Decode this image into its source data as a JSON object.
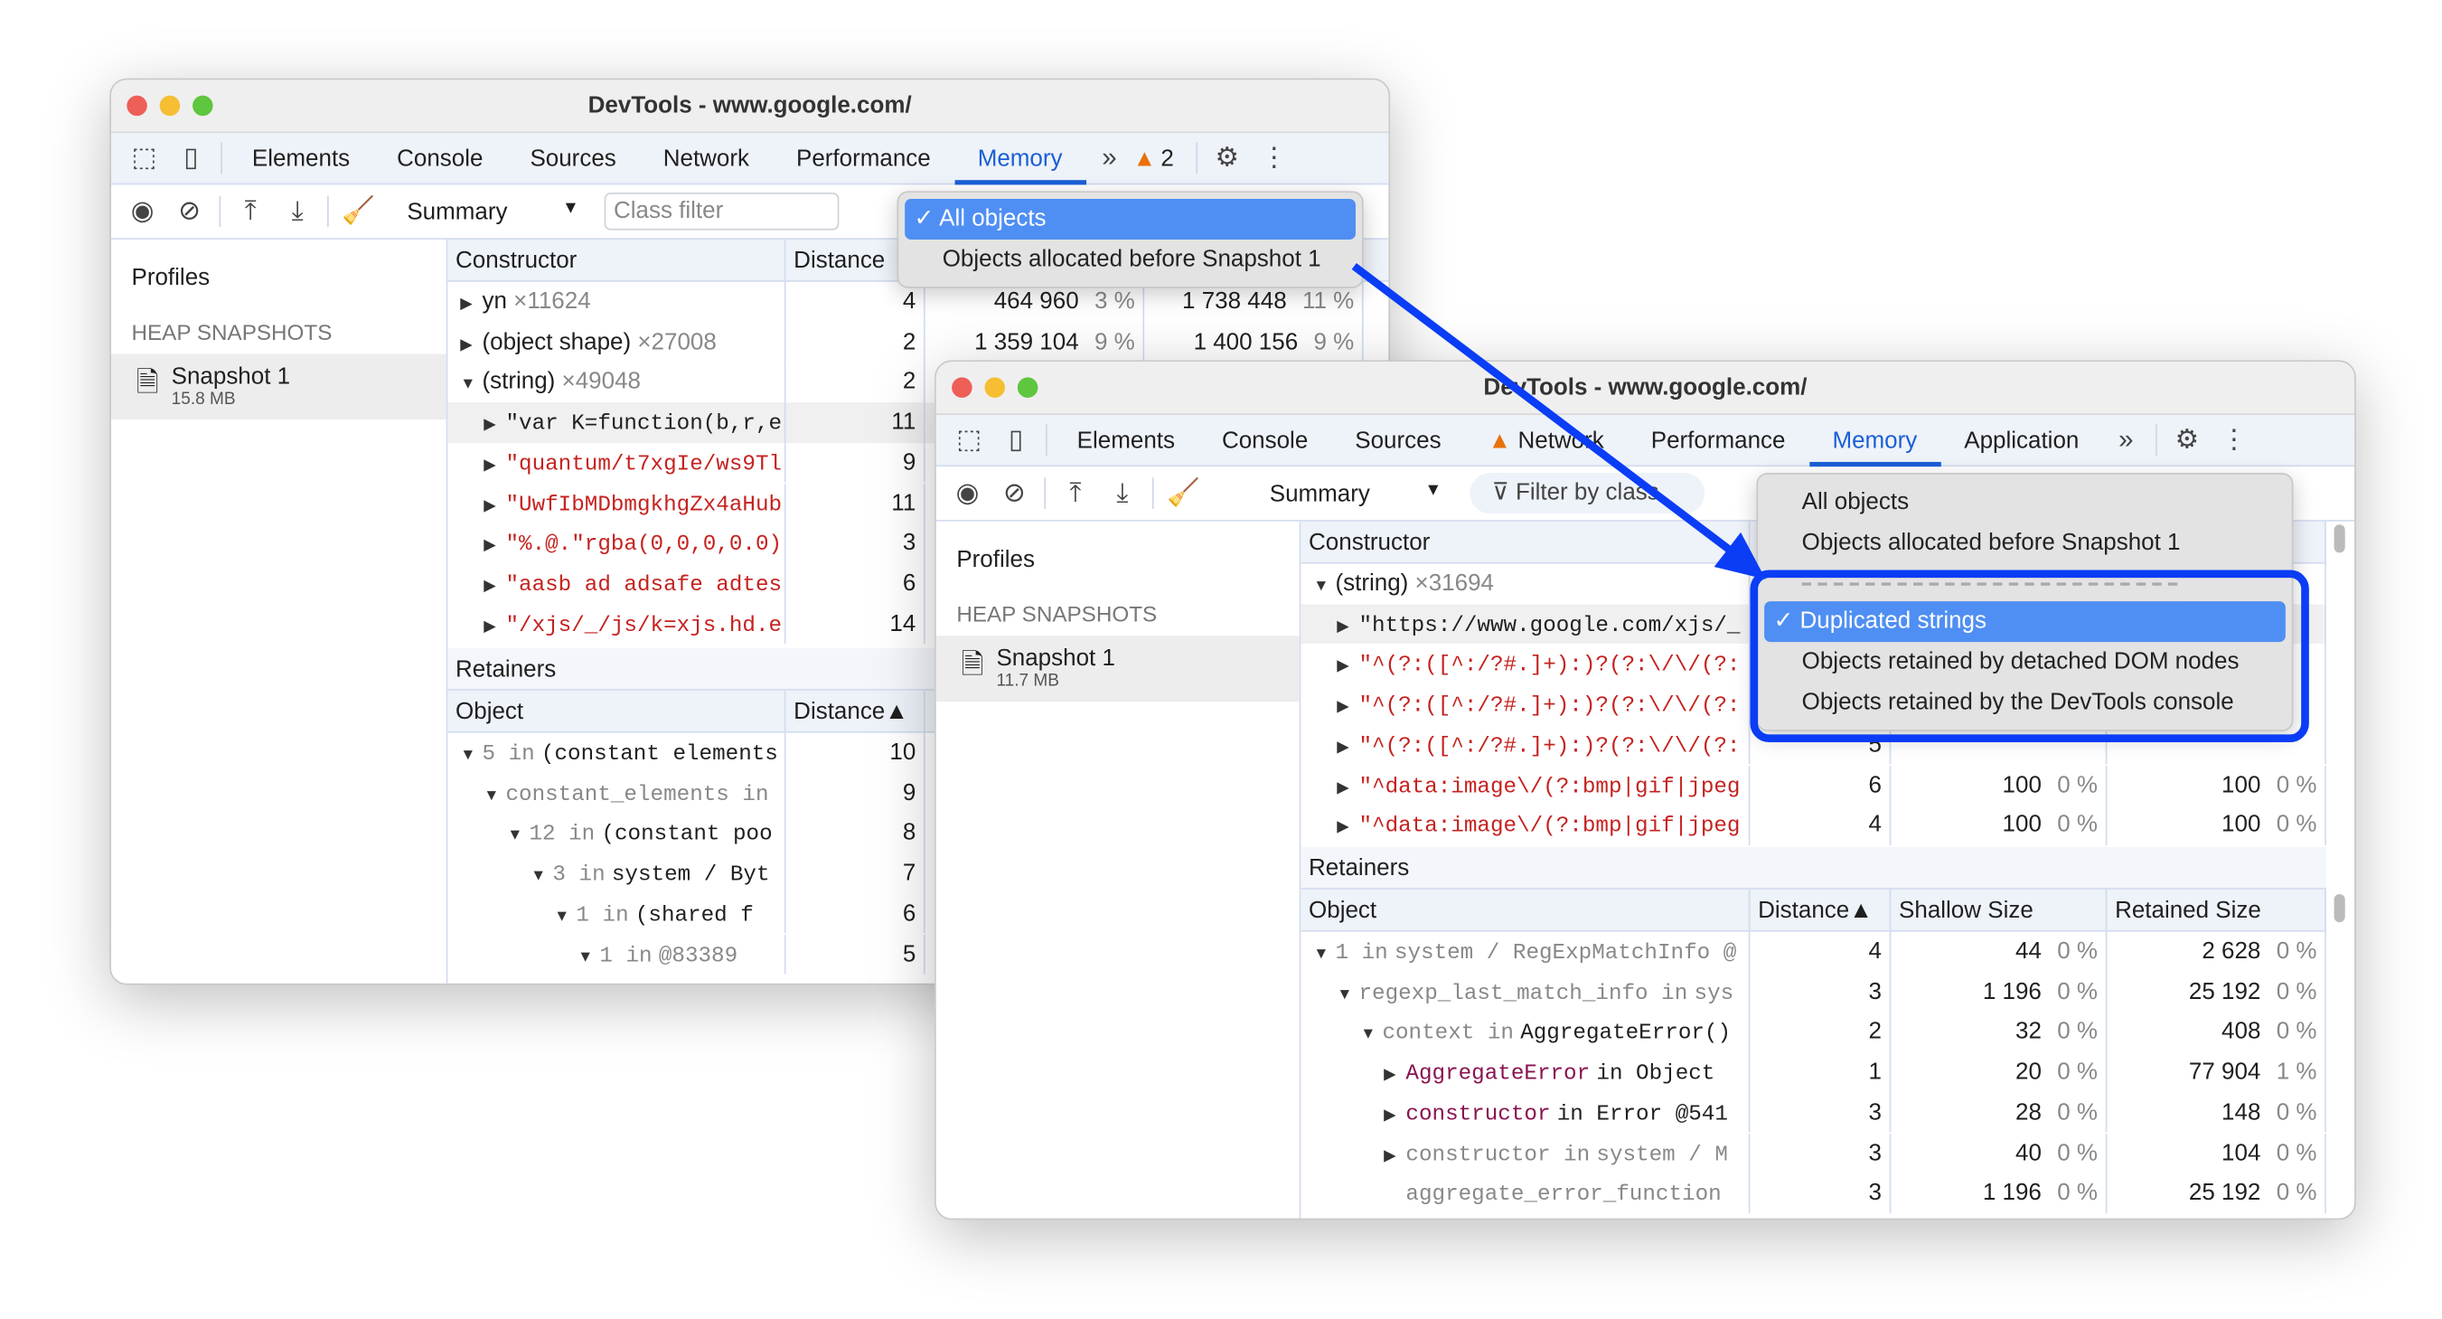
{
  "colors": {
    "accent": "#1a5fd6",
    "highlight": "#0a3df5",
    "menu_selected": "#4f8ff3",
    "string_red": "#c5221f"
  },
  "back": {
    "title": "DevTools - www.google.com/",
    "tabs": [
      "Elements",
      "Console",
      "Sources",
      "Network",
      "Performance",
      "Memory"
    ],
    "active_tab": "Memory",
    "warnings": "2",
    "view": "Summary",
    "class_filter_placeholder": "Class filter",
    "sidebar": {
      "profiles": "Profiles",
      "heap_snapshots": "HEAP SNAPSHOTS",
      "snapshot_name": "Snapshot 1",
      "snapshot_size": "15.8 MB"
    },
    "menu": {
      "items": [
        "All objects",
        "Objects allocated before Snapshot 1"
      ],
      "selected": "All objects"
    },
    "table": {
      "headers": [
        "Constructor",
        "Distance"
      ],
      "rows": [
        {
          "indent": 0,
          "arrow": "right",
          "name": "yn",
          "count": "×11624",
          "distance": "4",
          "shallow": "464 960",
          "shallow_pct": "3 %",
          "retained": "1 738 448",
          "retained_pct": "11 %"
        },
        {
          "indent": 0,
          "arrow": "right",
          "name": "(object shape)",
          "count": "×27008",
          "distance": "2",
          "shallow": "1 359 104",
          "shallow_pct": "9 %",
          "retained": "1 400 156",
          "retained_pct": "9 %"
        },
        {
          "indent": 0,
          "arrow": "down",
          "name": "(string)",
          "count": "×49048",
          "distance": "2"
        },
        {
          "indent": 1,
          "arrow": "right",
          "name": "\"var K=function(b,r,e",
          "style": "mono",
          "distance": "11",
          "selected": true
        },
        {
          "indent": 1,
          "arrow": "right",
          "name": "\"quantum/t7xgIe/ws9Tl",
          "style": "mono red",
          "distance": "9"
        },
        {
          "indent": 1,
          "arrow": "right",
          "name": "\"UwfIbMDbmgkhgZx4aHub",
          "style": "mono red",
          "distance": "11"
        },
        {
          "indent": 1,
          "arrow": "right",
          "name": "\"%.@.\"rgba(0,0,0,0.0)",
          "style": "mono red",
          "distance": "3"
        },
        {
          "indent": 1,
          "arrow": "right",
          "name": "\"aasb ad adsafe adtes",
          "style": "mono red",
          "distance": "6"
        },
        {
          "indent": 1,
          "arrow": "right",
          "name": "\"/xjs/_/js/k=xjs.hd.e",
          "style": "mono red",
          "distance": "14"
        }
      ]
    },
    "retainers": {
      "title": "Retainers",
      "headers": [
        "Object",
        "Distance▲"
      ],
      "rows": [
        {
          "indent": 0,
          "arrow": "down",
          "prefix": "5 in",
          "name": "(constant elements",
          "style": "mono",
          "distance": "10"
        },
        {
          "indent": 1,
          "arrow": "down",
          "prefix": "constant_elements in",
          "name": "",
          "style": "mono",
          "distance": "9"
        },
        {
          "indent": 2,
          "arrow": "down",
          "prefix": "12 in",
          "name": "(constant poo",
          "style": "mono",
          "distance": "8"
        },
        {
          "indent": 3,
          "arrow": "down",
          "prefix": "3 in",
          "name": "system / Byt",
          "style": "mono",
          "distance": "7"
        },
        {
          "indent": 4,
          "arrow": "down",
          "prefix": "1 in",
          "name": "(shared f",
          "style": "mono",
          "distance": "6"
        },
        {
          "indent": 5,
          "arrow": "down",
          "prefix": "1 in",
          "name": "@83389",
          "style": "mono grey",
          "distance": "5"
        }
      ]
    }
  },
  "front": {
    "title": "DevTools - www.google.com/",
    "tabs": [
      "Elements",
      "Console",
      "Sources",
      "Network",
      "Performance",
      "Memory",
      "Application"
    ],
    "active_tab": "Memory",
    "view": "Summary",
    "class_filter_placeholder": "Filter by class",
    "sidebar": {
      "profiles": "Profiles",
      "heap_snapshots": "HEAP SNAPSHOTS",
      "snapshot_name": "Snapshot 1",
      "snapshot_size": "11.7 MB"
    },
    "menu": {
      "items": [
        "All objects",
        "Objects allocated before Snapshot 1"
      ],
      "highlighted_items": [
        "Duplicated strings",
        "Objects retained by detached DOM nodes",
        "Objects retained by the DevTools console"
      ],
      "selected": "Duplicated strings"
    },
    "table": {
      "headers": [
        "Constructor"
      ],
      "rows": [
        {
          "indent": 0,
          "arrow": "down",
          "name": "(string)",
          "count": "×31694"
        },
        {
          "indent": 1,
          "arrow": "right",
          "name": "\"https://www.google.com/xjs/_",
          "style": "mono",
          "selected": true
        },
        {
          "indent": 1,
          "arrow": "right",
          "name": "\"^(?:([^:/?#.]+):)?(?:\\/\\/(?:",
          "style": "mono red"
        },
        {
          "indent": 1,
          "arrow": "right",
          "name": "\"^(?:([^:/?#.]+):)?(?:\\/\\/(?:",
          "style": "mono red"
        },
        {
          "indent": 1,
          "arrow": "right",
          "name": "\"^(?:([^:/?#.]+):)?(?:\\/\\/(?:",
          "style": "mono red",
          "distance": "5"
        },
        {
          "indent": 1,
          "arrow": "right",
          "name": "\"^data:image\\/(?:bmp|gif|jpeg",
          "style": "mono red",
          "distance": "6",
          "shallow": "100",
          "shallow_pct": "0 %",
          "retained": "100",
          "retained_pct": "0 %"
        },
        {
          "indent": 1,
          "arrow": "right",
          "name": "\"^data:image\\/(?:bmp|gif|jpeg",
          "style": "mono red",
          "distance": "4",
          "shallow": "100",
          "shallow_pct": "0 %",
          "retained": "100",
          "retained_pct": "0 %"
        }
      ]
    },
    "retainers": {
      "title": "Retainers",
      "headers": [
        "Object",
        "Distance▲",
        "Shallow Size",
        "Retained Size"
      ],
      "rows": [
        {
          "indent": 0,
          "arrow": "down",
          "prefix": "1 in",
          "name": "system / RegExpMatchInfo @",
          "style": "mono grey",
          "distance": "4",
          "shallow": "44",
          "shallow_pct": "0 %",
          "retained": "2 628",
          "retained_pct": "0 %"
        },
        {
          "indent": 1,
          "arrow": "down",
          "prefix": "regexp_last_match_info in",
          "name": "sys",
          "style": "mono grey",
          "distance": "3",
          "shallow": "1 196",
          "shallow_pct": "0 %",
          "retained": "25 192",
          "retained_pct": "0 %"
        },
        {
          "indent": 2,
          "arrow": "down",
          "prefix": "context in",
          "name": "AggregateError()",
          "style": "mono",
          "distance": "2",
          "shallow": "32",
          "shallow_pct": "0 %",
          "retained": "408",
          "retained_pct": "0 %"
        },
        {
          "indent": 3,
          "arrow": "right",
          "prefix": "AggregateError",
          "name": "in Object",
          "style": "mono",
          "prefix_style": "purple",
          "distance": "1",
          "shallow": "20",
          "shallow_pct": "0 %",
          "retained": "77 904",
          "retained_pct": "1 %"
        },
        {
          "indent": 3,
          "arrow": "right",
          "prefix": "constructor",
          "name": "in Error @541",
          "style": "mono",
          "prefix_style": "purple",
          "distance": "3",
          "shallow": "28",
          "shallow_pct": "0 %",
          "retained": "148",
          "retained_pct": "0 %"
        },
        {
          "indent": 3,
          "arrow": "right",
          "prefix": "constructor in",
          "name": "system / M",
          "style": "mono grey",
          "distance": "3",
          "shallow": "40",
          "shallow_pct": "0 %",
          "retained": "104",
          "retained_pct": "0 %"
        },
        {
          "indent": 3,
          "arrow": "",
          "prefix": "aggregate_error_function",
          "name": "",
          "style": "mono grey",
          "distance": "3",
          "shallow": "1 196",
          "shallow_pct": "0 %",
          "retained": "25 192",
          "retained_pct": "0 %"
        }
      ]
    }
  }
}
